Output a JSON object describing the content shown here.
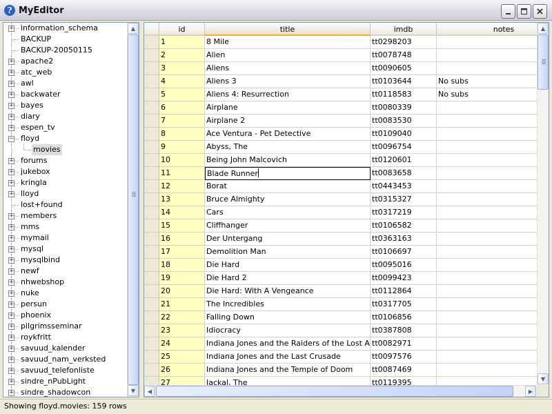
{
  "window": {
    "title": "MyEditor",
    "icon": "help-question-icon",
    "controls": [
      "minimize",
      "maximize",
      "close"
    ]
  },
  "tree": {
    "items": [
      {
        "label": "information_schema",
        "expandable": true
      },
      {
        "label": "BACKUP",
        "expandable": false
      },
      {
        "label": "BACKUP-20050115",
        "expandable": false
      },
      {
        "label": "apache2",
        "expandable": true
      },
      {
        "label": "atc_web",
        "expandable": true
      },
      {
        "label": "awl",
        "expandable": true
      },
      {
        "label": "backwater",
        "expandable": true
      },
      {
        "label": "bayes",
        "expandable": true
      },
      {
        "label": "diary",
        "expandable": true
      },
      {
        "label": "espen_tv",
        "expandable": true
      },
      {
        "label": "floyd",
        "expandable": true,
        "expanded": true
      },
      {
        "label": "movies",
        "child": true,
        "selected": true
      },
      {
        "label": "forums",
        "expandable": true
      },
      {
        "label": "jukebox",
        "expandable": true
      },
      {
        "label": "kringla",
        "expandable": true
      },
      {
        "label": "lloyd",
        "expandable": true
      },
      {
        "label": "lost+found",
        "expandable": false
      },
      {
        "label": "members",
        "expandable": true
      },
      {
        "label": "mms",
        "expandable": true
      },
      {
        "label": "mymail",
        "expandable": true
      },
      {
        "label": "mysql",
        "expandable": true
      },
      {
        "label": "mysqlbind",
        "expandable": true
      },
      {
        "label": "newf",
        "expandable": true
      },
      {
        "label": "nhwebshop",
        "expandable": true
      },
      {
        "label": "nuke",
        "expandable": true
      },
      {
        "label": "persun",
        "expandable": true
      },
      {
        "label": "phoenix",
        "expandable": true
      },
      {
        "label": "pilgrimsseminar",
        "expandable": true
      },
      {
        "label": "roykfritt",
        "expandable": true
      },
      {
        "label": "savuud_kalender",
        "expandable": true
      },
      {
        "label": "savuud_nam_verksted",
        "expandable": true
      },
      {
        "label": "savuud_telefonliste",
        "expandable": true
      },
      {
        "label": "sindre_nPubLight",
        "expandable": true
      },
      {
        "label": "sindre_shadowcon",
        "expandable": true
      }
    ]
  },
  "grid": {
    "columns": [
      "id",
      "title",
      "imdb",
      "notes"
    ],
    "selected_column": "title",
    "editing_row": 11,
    "rows": [
      {
        "id": "1",
        "title": "8 Mile",
        "imdb": "tt0298203",
        "notes": ""
      },
      {
        "id": "2",
        "title": "Alien",
        "imdb": "tt0078748",
        "notes": ""
      },
      {
        "id": "3",
        "title": "Aliens",
        "imdb": "tt0090605",
        "notes": ""
      },
      {
        "id": "4",
        "title": "Aliens 3",
        "imdb": "tt0103644",
        "notes": "No subs"
      },
      {
        "id": "5",
        "title": "Aliens 4: Resurrection",
        "imdb": "tt0118583",
        "notes": "No subs"
      },
      {
        "id": "6",
        "title": "Airplane",
        "imdb": "tt0080339",
        "notes": ""
      },
      {
        "id": "7",
        "title": "Airplane 2",
        "imdb": "tt0083530",
        "notes": ""
      },
      {
        "id": "8",
        "title": "Ace Ventura - Pet Detective",
        "imdb": "tt0109040",
        "notes": ""
      },
      {
        "id": "9",
        "title": "Abyss, The",
        "imdb": "tt0096754",
        "notes": ""
      },
      {
        "id": "10",
        "title": "Being John Malcovich",
        "imdb": "tt0120601",
        "notes": ""
      },
      {
        "id": "11",
        "title": "Blade Runner",
        "imdb": "tt0083658",
        "notes": ""
      },
      {
        "id": "12",
        "title": "Borat",
        "imdb": "tt0443453",
        "notes": ""
      },
      {
        "id": "13",
        "title": "Bruce Almighty",
        "imdb": "tt0315327",
        "notes": ""
      },
      {
        "id": "14",
        "title": "Cars",
        "imdb": "tt0317219",
        "notes": ""
      },
      {
        "id": "15",
        "title": "Cliffhanger",
        "imdb": "tt0106582",
        "notes": ""
      },
      {
        "id": "16",
        "title": "Der Untergang",
        "imdb": "tt0363163",
        "notes": ""
      },
      {
        "id": "17",
        "title": "Demolition Man",
        "imdb": "tt0106697",
        "notes": ""
      },
      {
        "id": "18",
        "title": "Die Hard",
        "imdb": "tt0095016",
        "notes": ""
      },
      {
        "id": "19",
        "title": "Die Hard 2",
        "imdb": "tt0099423",
        "notes": ""
      },
      {
        "id": "20",
        "title": "Die Hard: With A Vengeance",
        "imdb": "tt0112864",
        "notes": ""
      },
      {
        "id": "21",
        "title": "The Incredibles",
        "imdb": "tt0317705",
        "notes": ""
      },
      {
        "id": "22",
        "title": "Falling Down",
        "imdb": "tt0106856",
        "notes": ""
      },
      {
        "id": "23",
        "title": "Idiocracy",
        "imdb": "tt0387808",
        "notes": ""
      },
      {
        "id": "24",
        "title": "Indiana Jones and the Raiders of the Lost Ark",
        "imdb": "tt0082971",
        "notes": ""
      },
      {
        "id": "25",
        "title": "Indiana Jones and the Last Crusade",
        "imdb": "tt0097576",
        "notes": ""
      },
      {
        "id": "26",
        "title": "Indiana Jones and the Temple of Doom",
        "imdb": "tt0087469",
        "notes": ""
      },
      {
        "id": "27",
        "title": "Jackal, The",
        "imdb": "tt0119395",
        "notes": ""
      }
    ]
  },
  "status": {
    "text": "Showing floyd.movies: 159 rows"
  },
  "colors": {
    "id_column_bg": "#ffffc0",
    "selected_header_accent": "#f9b119",
    "window_bg": "#ece9d8",
    "pane_border": "#7f9db9"
  }
}
